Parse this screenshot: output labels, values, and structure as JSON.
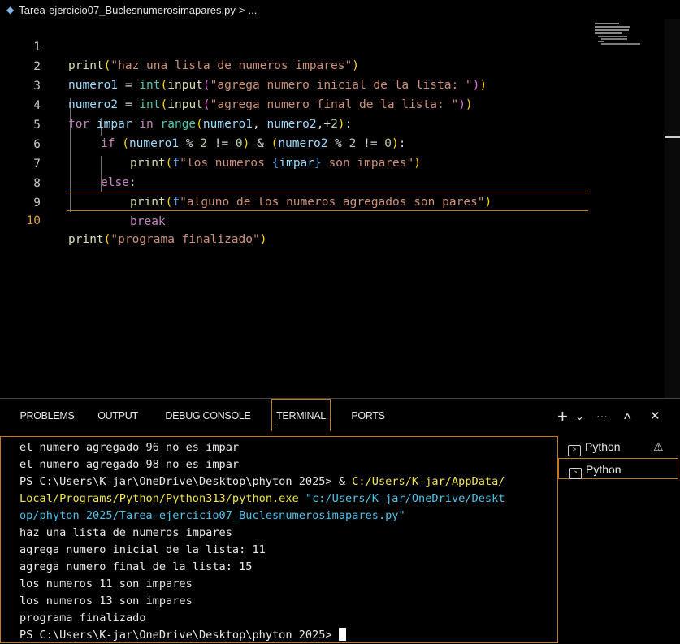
{
  "breadcrumb": {
    "file": "Tarea-ejercicio07_Buclesnumerosimapares.py",
    "sep": ">",
    "more": "..."
  },
  "editor": {
    "lines": [
      {
        "n": "1"
      },
      {
        "n": "2"
      },
      {
        "n": "3"
      },
      {
        "n": "4"
      },
      {
        "n": "5"
      },
      {
        "n": "6"
      },
      {
        "n": "7"
      },
      {
        "n": "8"
      },
      {
        "n": "9"
      },
      {
        "n": "10"
      }
    ],
    "code": {
      "l1": {
        "print": "print",
        "p1": "(",
        "s": "\"haz una lista de numeros impares\"",
        "p2": ")"
      },
      "l2": {
        "v": "numero1",
        "eq": " = ",
        "int": "int",
        "p1": "(",
        "input": "input",
        "p2": "(",
        "s": "\"agrega numero inicial de la lista: \"",
        "p3": ")",
        "p4": ")"
      },
      "l3": {
        "v": "numero2",
        "eq": " = ",
        "int": "int",
        "p1": "(",
        "input": "input",
        "p2": "(",
        "s": "\"agrega numero final de la lista: \"",
        "p3": ")",
        "p4": ")"
      },
      "l4": {
        "for": "for",
        "sp": " ",
        "v": "impar",
        "in": " in ",
        "range": "range",
        "p1": "(",
        "a": "numero1",
        "c1": ", ",
        "b": "numero2",
        "c2": ",+",
        "n": "2",
        "p2": ")",
        "colon": ":"
      },
      "l5": {
        "if": "if",
        "sp": " ",
        "p1": "(",
        "a": "numero1",
        "m": " % ",
        "n1": "2",
        "ne": " != ",
        "n2": "0",
        "p2": ")",
        "amp": " & ",
        "p3": "(",
        "b": "numero2",
        "m2": " % ",
        "n3": "2",
        "ne2": " != ",
        "n4": "0",
        "p4": ")",
        "colon": ":"
      },
      "l6": {
        "print": "print",
        "p1": "(",
        "f": "f",
        "s1": "\"los numeros ",
        "b1": "{",
        "v": "impar",
        "b2": "}",
        "s2": " son impares\"",
        "p2": ")"
      },
      "l7": {
        "else": "else",
        "colon": ":"
      },
      "l8": {
        "print": "print",
        "p1": "(",
        "f": "f",
        "s": "\"alguno de los numeros agregados son pares\"",
        "p2": ")"
      },
      "l9": {
        "break": "break"
      },
      "l10": {
        "print": "print",
        "p1": "(",
        "s": "\"programa finalizado\"",
        "p2": ")"
      }
    }
  },
  "panel": {
    "tabs": [
      "PROBLEMS",
      "OUTPUT",
      "DEBUG CONSOLE",
      "TERMINAL",
      "PORTS"
    ],
    "active_tab": "TERMINAL",
    "actions": {
      "add": "+",
      "chev": "⌄",
      "more": "···",
      "up": "^",
      "close": "✕"
    }
  },
  "terminal": {
    "lines": [
      "el numero agregado 96 no es impar",
      "el numero agregado 98 no es impar"
    ],
    "cmd_prompt": "PS C:\\Users\\K-jar\\OneDrive\\Desktop\\phyton 2025> ",
    "cmd_amp": "& ",
    "cmd_exe_1": "C:/Users/K-jar/AppData/",
    "cmd_exe_2": "Local/Programs/Python/Python313/python.exe",
    "cmd_arg_1": " \"c:/Users/K-jar/OneDrive/Deskt",
    "cmd_arg_2": "op/phyton 2025/Tarea-ejercicio07_Buclesnumerosimapares.py\"",
    "output": [
      "haz una lista de numeros impares",
      "agrega numero inicial de la lista: 11",
      "agrega numero final de la lista: 15",
      "los numeros 11 son impares",
      "los numeros 13 son impares",
      "programa finalizado"
    ],
    "final_prompt": "PS C:\\Users\\K-jar\\OneDrive\\Desktop\\phyton 2025> "
  },
  "terminal_list": [
    {
      "label": "Python",
      "icon": "terminal-icon",
      "warn": "⚠"
    },
    {
      "label": "Python",
      "icon": "terminal-icon"
    }
  ]
}
